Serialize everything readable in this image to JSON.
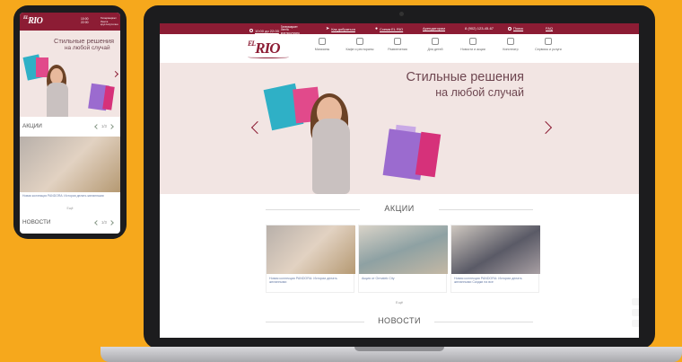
{
  "desktop": {
    "topbar": {
      "hours": "10:00 до 22:00",
      "hours_note": "Гипермаркет Лента круглосуточно",
      "route": "Как добраться",
      "address": "Схема EL RIO",
      "store": "Арендаторам",
      "phone": "8 (902) 123-45-67",
      "search": "Поиск",
      "faq": "FAQ"
    },
    "logo": {
      "prefix": "EL",
      "main": "RIO"
    },
    "nav": [
      "Магазины",
      "Кафе и рестораны",
      "Развлечения",
      "Для детей",
      "Новости и акции",
      "Кинотеатр",
      "Сервисы и услуги"
    ],
    "hero": {
      "title_line1": "Стильные решения",
      "title_line2": "на любой случай"
    },
    "promotions": {
      "title": "АКЦИИ",
      "cards": [
        {
          "text": "Новая коллекция PANDORA: Истории делать желанными"
        },
        {
          "text": "Акция от Ormatek City"
        },
        {
          "text": "Новая коллекция PANDORA: Истории делать желанными"
        }
      ],
      "more": "Ещё",
      "card3_extra": "Скидки на все"
    },
    "news": {
      "title": "НОВОСТИ"
    }
  },
  "phone": {
    "header": {
      "logo_prefix": "EL",
      "logo_main": "RIO",
      "time_from": "10:00",
      "time_to": "22:00",
      "note": "Гипермаркет Лента круглосуточно"
    },
    "hero": {
      "title_line1": "Стильные решения",
      "title_line2": "на любой случай"
    },
    "promotions": {
      "title": "АКЦИИ",
      "pager": "1/3",
      "card_text": "Новая коллекция PANDORA: Истории делать желанными",
      "more": "Ещё"
    },
    "news": {
      "title": "НОВОСТИ",
      "pager": "1/3"
    }
  },
  "colors": {
    "brand": "#8c1c34",
    "background": "#f6a81c",
    "hero_bg": "#f2e5e3",
    "hero_text": "#6e4650"
  }
}
